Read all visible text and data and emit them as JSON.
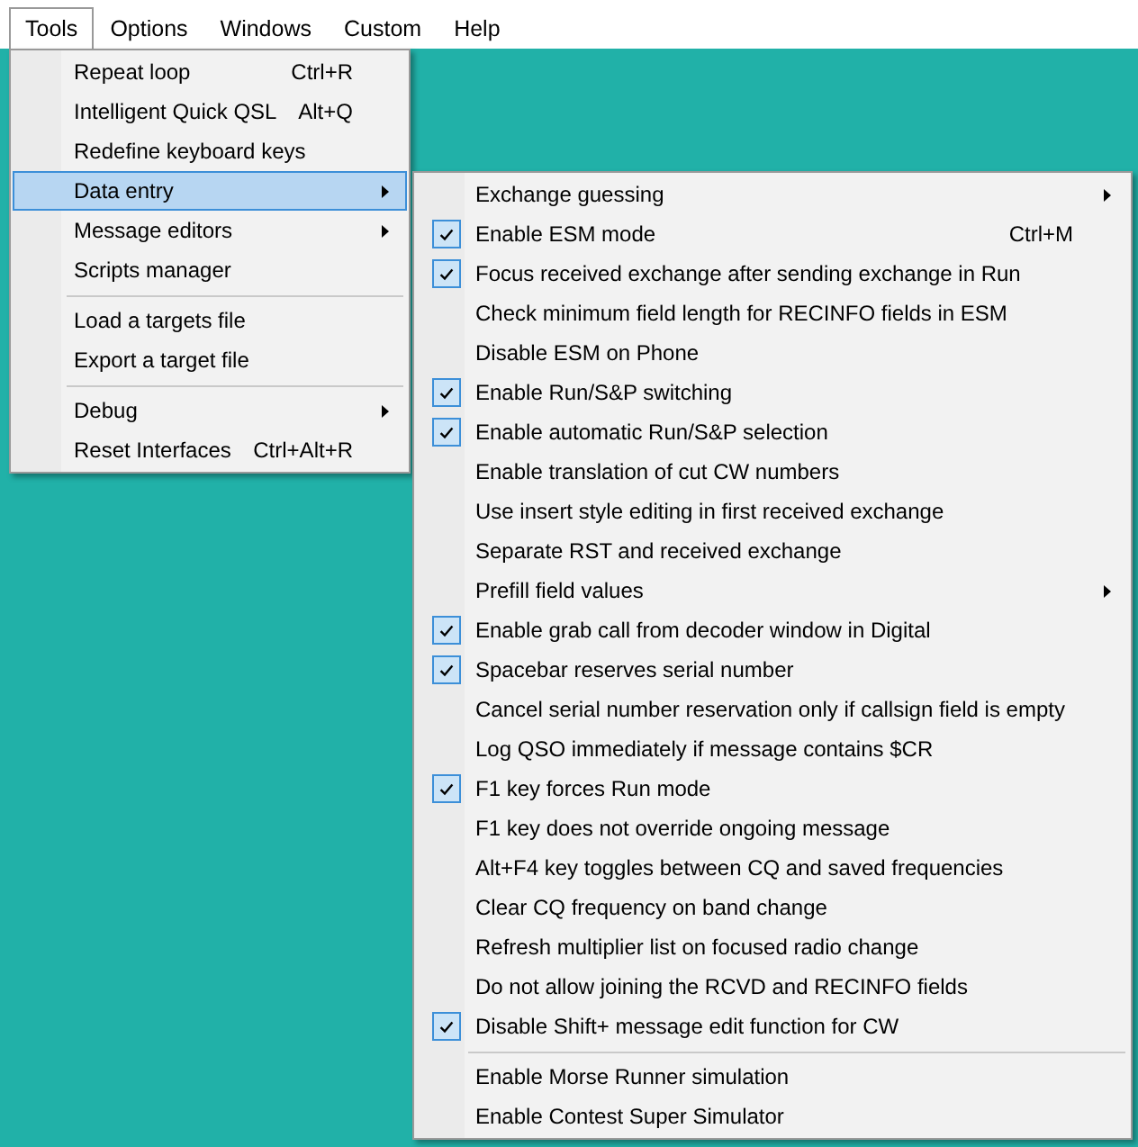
{
  "menubar": [
    {
      "label": "Tools",
      "selected": true
    },
    {
      "label": "Options",
      "selected": false
    },
    {
      "label": "Windows",
      "selected": false
    },
    {
      "label": "Custom",
      "selected": false
    },
    {
      "label": "Help",
      "selected": false
    }
  ],
  "tools_menu": {
    "items": [
      {
        "kind": "item",
        "label": "Repeat loop",
        "shortcut": "Ctrl+R",
        "submenu": false,
        "selected": false
      },
      {
        "kind": "item",
        "label": "Intelligent Quick QSL",
        "shortcut": "Alt+Q",
        "submenu": false,
        "selected": false
      },
      {
        "kind": "item",
        "label": "Redefine keyboard keys",
        "submenu": false,
        "selected": false
      },
      {
        "kind": "item",
        "label": "Data entry",
        "submenu": true,
        "selected": true
      },
      {
        "kind": "item",
        "label": "Message editors",
        "submenu": true,
        "selected": false
      },
      {
        "kind": "item",
        "label": "Scripts manager",
        "submenu": false,
        "selected": false
      },
      {
        "kind": "separator"
      },
      {
        "kind": "item",
        "label": "Load a targets file",
        "submenu": false,
        "selected": false
      },
      {
        "kind": "item",
        "label": "Export a target file",
        "submenu": false,
        "selected": false
      },
      {
        "kind": "separator"
      },
      {
        "kind": "item",
        "label": "Debug",
        "submenu": true,
        "selected": false
      },
      {
        "kind": "item",
        "label": "Reset Interfaces",
        "shortcut": "Ctrl+Alt+R",
        "submenu": false,
        "selected": false
      }
    ]
  },
  "data_entry_menu": {
    "items": [
      {
        "kind": "item",
        "label": "Exchange guessing",
        "submenu": true,
        "checked": false
      },
      {
        "kind": "item",
        "label": "Enable ESM mode",
        "shortcut": "Ctrl+M",
        "submenu": false,
        "checked": true
      },
      {
        "kind": "item",
        "label": "Focus received exchange after sending exchange in Run",
        "submenu": false,
        "checked": true
      },
      {
        "kind": "item",
        "label": "Check minimum field length for RECINFO fields in ESM",
        "submenu": false,
        "checked": false
      },
      {
        "kind": "item",
        "label": "Disable ESM on Phone",
        "submenu": false,
        "checked": false
      },
      {
        "kind": "item",
        "label": "Enable Run/S&P switching",
        "submenu": false,
        "checked": true
      },
      {
        "kind": "item",
        "label": "Enable automatic Run/S&P selection",
        "submenu": false,
        "checked": true
      },
      {
        "kind": "item",
        "label": "Enable translation of cut CW numbers",
        "submenu": false,
        "checked": false
      },
      {
        "kind": "item",
        "label": "Use insert style editing in first received exchange",
        "submenu": false,
        "checked": false
      },
      {
        "kind": "item",
        "label": "Separate RST and received exchange",
        "submenu": false,
        "checked": false
      },
      {
        "kind": "item",
        "label": "Prefill field values",
        "submenu": true,
        "checked": false
      },
      {
        "kind": "item",
        "label": "Enable grab call from decoder window in Digital",
        "submenu": false,
        "checked": true
      },
      {
        "kind": "item",
        "label": "Spacebar reserves serial number",
        "submenu": false,
        "checked": true
      },
      {
        "kind": "item",
        "label": "Cancel serial number reservation only if callsign field is empty",
        "submenu": false,
        "checked": false
      },
      {
        "kind": "item",
        "label": "Log QSO immediately if message contains $CR",
        "submenu": false,
        "checked": false
      },
      {
        "kind": "item",
        "label": "F1 key forces Run mode",
        "submenu": false,
        "checked": true
      },
      {
        "kind": "item",
        "label": "F1 key does not override ongoing message",
        "submenu": false,
        "checked": false
      },
      {
        "kind": "item",
        "label": "Alt+F4 key toggles between CQ and saved frequencies",
        "submenu": false,
        "checked": false
      },
      {
        "kind": "item",
        "label": "Clear CQ frequency on band change",
        "submenu": false,
        "checked": false
      },
      {
        "kind": "item",
        "label": "Refresh multiplier list on focused radio change",
        "submenu": false,
        "checked": false
      },
      {
        "kind": "item",
        "label": "Do not allow joining the RCVD and RECINFO fields",
        "submenu": false,
        "checked": false
      },
      {
        "kind": "item",
        "label": "Disable Shift+ message edit function for CW",
        "submenu": false,
        "checked": true
      },
      {
        "kind": "separator"
      },
      {
        "kind": "item",
        "label": "Enable Morse Runner simulation",
        "submenu": false,
        "checked": false
      },
      {
        "kind": "item",
        "label": "Enable Contest Super Simulator",
        "submenu": false,
        "checked": false
      }
    ]
  }
}
